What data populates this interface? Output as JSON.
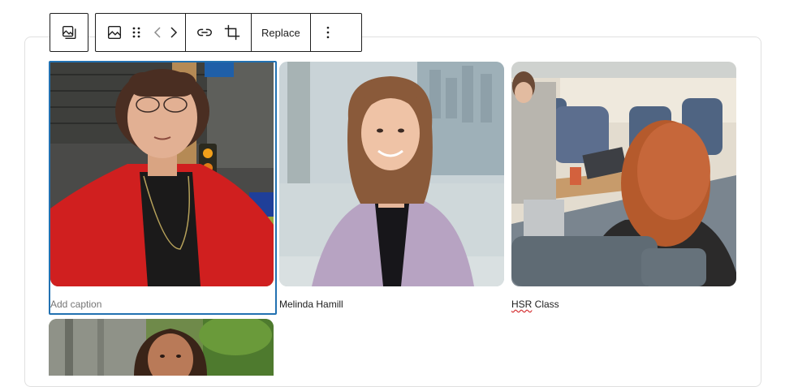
{
  "toolbar": {
    "replace_label": "Replace",
    "icons": [
      "gallery-switch-icon",
      "image-icon",
      "drag-handle-icon",
      "chevron-left-icon",
      "chevron-right-icon",
      "link-icon",
      "crop-icon",
      "more-options-icon"
    ]
  },
  "gallery": {
    "images": [
      {
        "caption": "",
        "placeholder": "Add caption",
        "selected": true
      },
      {
        "caption": "Melinda Hamill"
      },
      {
        "caption_parts": [
          "HSR",
          " Class"
        ]
      },
      {
        "caption": ""
      }
    ]
  },
  "colors": {
    "selection": "#2271b1",
    "toolbar_border": "#1e1e1e",
    "spellcheck": "#d63638"
  }
}
